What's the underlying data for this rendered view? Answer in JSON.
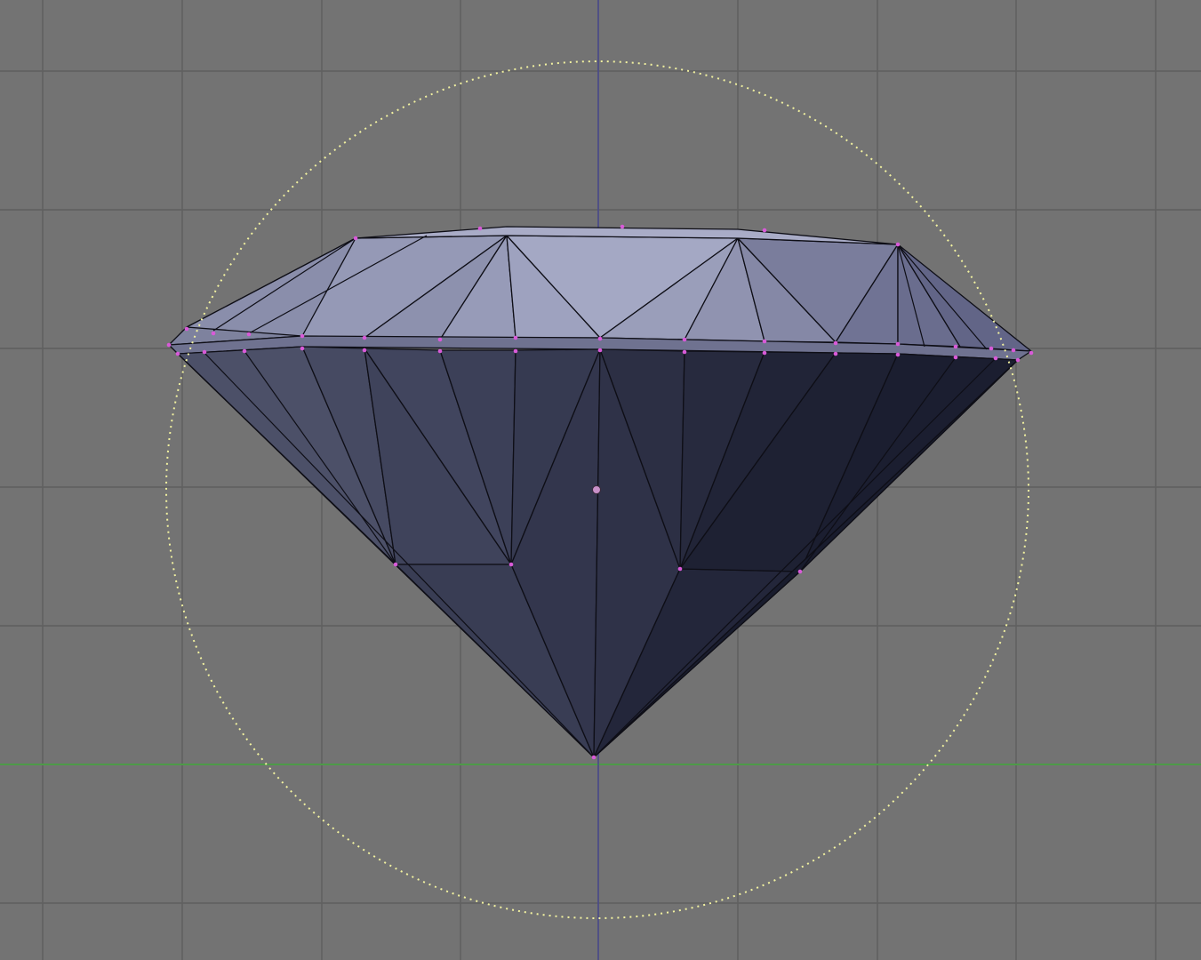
{
  "viewport": {
    "view": "3d-viewport-front-ortho",
    "object": "diamond-mesh",
    "mode": "edit",
    "colors": {
      "background": "#737373",
      "grid": "#5e5e5e",
      "x_axis": "#4e9a48",
      "z_axis": "#4a4a8a",
      "vertex_selected": "#d85ad8",
      "proportional_circle": "#f2f2a0",
      "crown_face": "#8c90ad",
      "pavilion_face": "#3a3d52"
    },
    "icons": [
      "object-origin-icon"
    ]
  }
}
